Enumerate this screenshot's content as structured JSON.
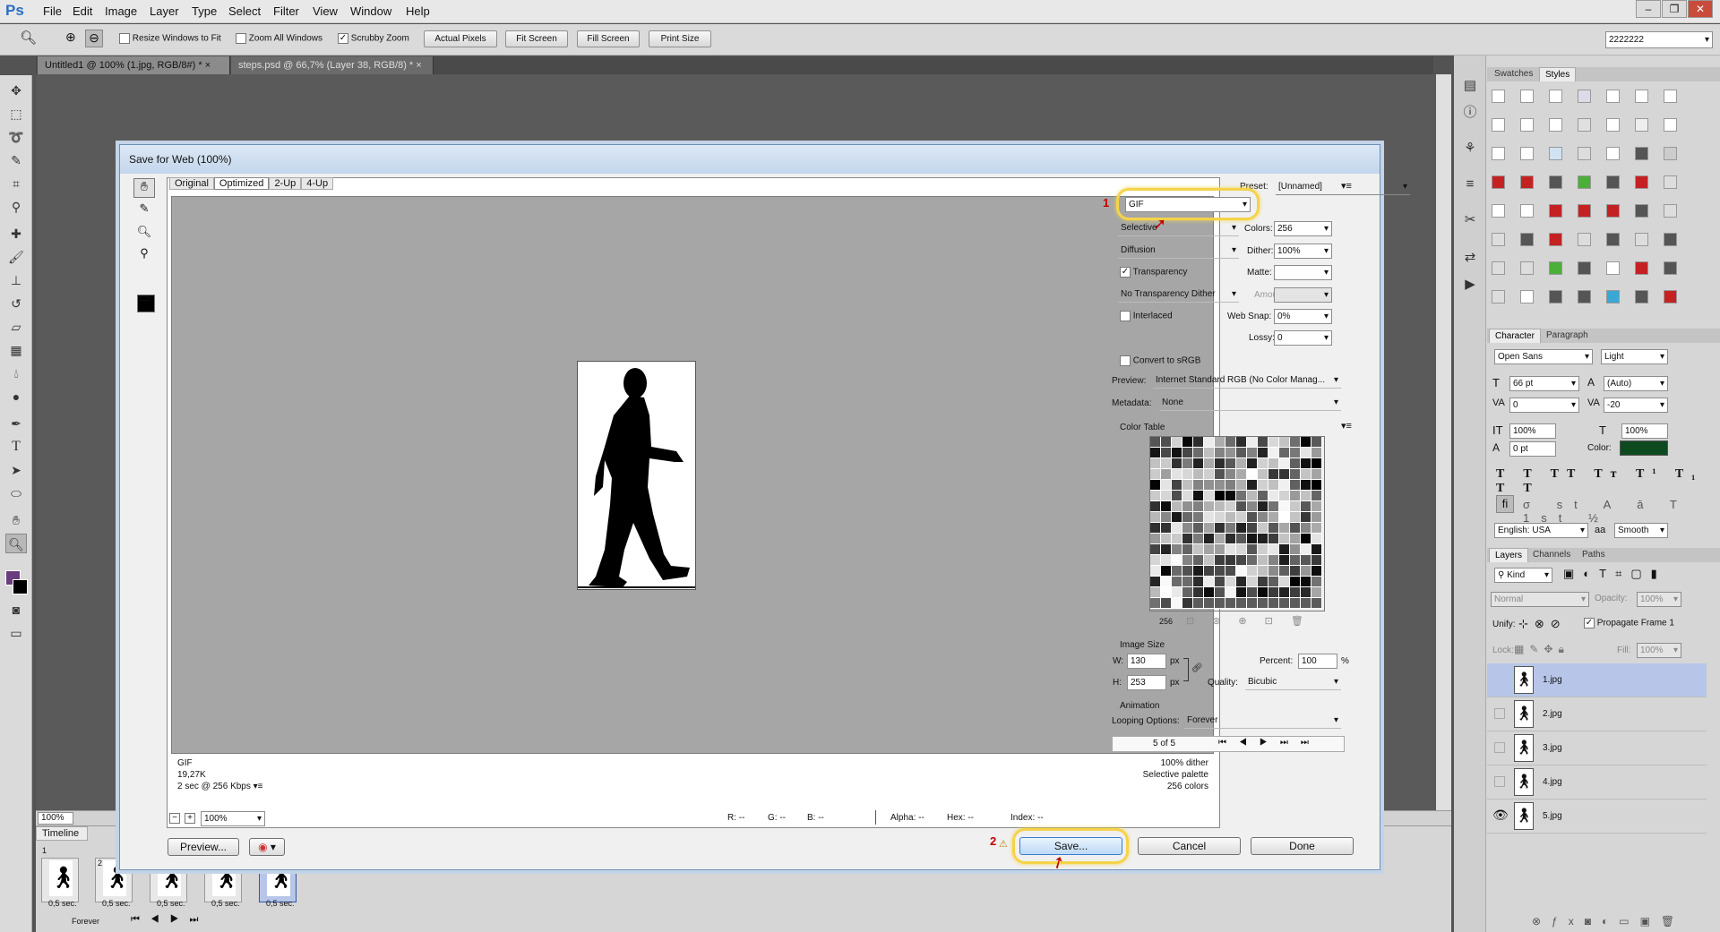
{
  "app": {
    "logo": "Ps",
    "menu": [
      "File",
      "Edit",
      "Image",
      "Layer",
      "Type",
      "Select",
      "Filter",
      "View",
      "Window",
      "Help"
    ],
    "workspace": "2222222"
  },
  "options": {
    "resize_windows": "Resize Windows to Fit",
    "zoom_all": "Zoom All Windows",
    "scrubby": "Scrubby Zoom",
    "actual_pixels": "Actual Pixels",
    "fit_screen": "Fit Screen",
    "fill_screen": "Fill Screen",
    "print_size": "Print Size"
  },
  "doc_tabs": [
    "Untitled1 @ 100% (1.jpg, RGB/8#) *",
    "steps.psd @ 66,7% (Layer 38, RGB/8) *"
  ],
  "status": {
    "zoom": "100%"
  },
  "timeline": {
    "title": "Timeline",
    "loop": "Forever",
    "frames": [
      {
        "num": "1",
        "delay": "0,5 sec."
      },
      {
        "num": "2",
        "delay": "0,5 sec."
      },
      {
        "num": "",
        "delay": "0,5 sec."
      },
      {
        "num": "",
        "delay": "0,5 sec."
      },
      {
        "num": "",
        "delay": "0,5 sec."
      }
    ]
  },
  "dialog": {
    "title": "Save for Web (100%)",
    "view_tabs": [
      "Original",
      "Optimized",
      "2-Up",
      "4-Up"
    ],
    "info_left": [
      "GIF",
      "19,27K",
      "2 sec @ 256 Kbps"
    ],
    "info_right": [
      "100% dither",
      "Selective palette",
      "256 colors"
    ],
    "zoom": "100%",
    "readout": {
      "r": "R: --",
      "g": "G: --",
      "b": "B: --",
      "alpha": "Alpha: --",
      "hex": "Hex: --",
      "index": "Index: --"
    },
    "preview_btn": "Preview...",
    "save_btn": "Save...",
    "cancel_btn": "Cancel",
    "done_btn": "Done",
    "callout1": "1",
    "callout2": "2",
    "settings": {
      "preset_label": "Preset:",
      "preset_value": "[Unnamed]",
      "format": "GIF",
      "palette": "Selective",
      "colors_label": "Colors:",
      "colors": "256",
      "dither_algo": "Diffusion",
      "dither_label": "Dither:",
      "dither": "100%",
      "transparency": "Transparency",
      "matte_label": "Matte:",
      "trans_dither": "No Transparency Dither",
      "amount_label": "Amount:",
      "interlaced": "Interlaced",
      "websnap_label": "Web Snap:",
      "websnap": "0%",
      "lossy_label": "Lossy:",
      "lossy": "0",
      "convert_srgb": "Convert to sRGB",
      "preview_label": "Preview:",
      "preview_value": "Internet Standard RGB (No Color Manag...",
      "metadata_label": "Metadata:",
      "metadata_value": "None",
      "color_table_label": "Color Table",
      "color_count": "256",
      "image_size_label": "Image Size",
      "w_label": "W:",
      "w": "130",
      "h_label": "H:",
      "h": "253",
      "px": "px",
      "percent_label": "Percent:",
      "percent": "100",
      "percent_unit": "%",
      "quality_label": "Quality:",
      "quality": "Bicubic",
      "animation_label": "Animation",
      "looping_label": "Looping Options:",
      "looping": "Forever",
      "frame_counter": "5 of 5"
    }
  },
  "panels": {
    "swatch_tabs": [
      "Swatches",
      "Styles"
    ],
    "char_tabs": [
      "Character",
      "Paragraph"
    ],
    "font_family": "Open Sans",
    "font_style": "Light",
    "font_size": "66 pt",
    "leading": "(Auto)",
    "kerning": "0",
    "tracking": "-20",
    "vscale": "100%",
    "hscale": "100%",
    "baseline": "0 pt",
    "color_label": "Color:",
    "language": "English: USA",
    "aa_label": "aa",
    "aa": "Smooth",
    "layer_tabs": [
      "Layers",
      "Channels",
      "Paths"
    ],
    "kind": "Kind",
    "blend": "Normal",
    "opacity_label": "Opacity:",
    "opacity": "100%",
    "unify_label": "Unify:",
    "propagate": "Propagate Frame 1",
    "lock_label": "Lock:",
    "fill_label": "Fill:",
    "fill": "100%",
    "layers": [
      "1.jpg",
      "2.jpg",
      "3.jpg",
      "4.jpg",
      "5.jpg"
    ]
  },
  "colors": {
    "accent": "#3b5ea8",
    "highlight": "#f5d34a",
    "text_color_swatch": "#0e4a1f"
  }
}
